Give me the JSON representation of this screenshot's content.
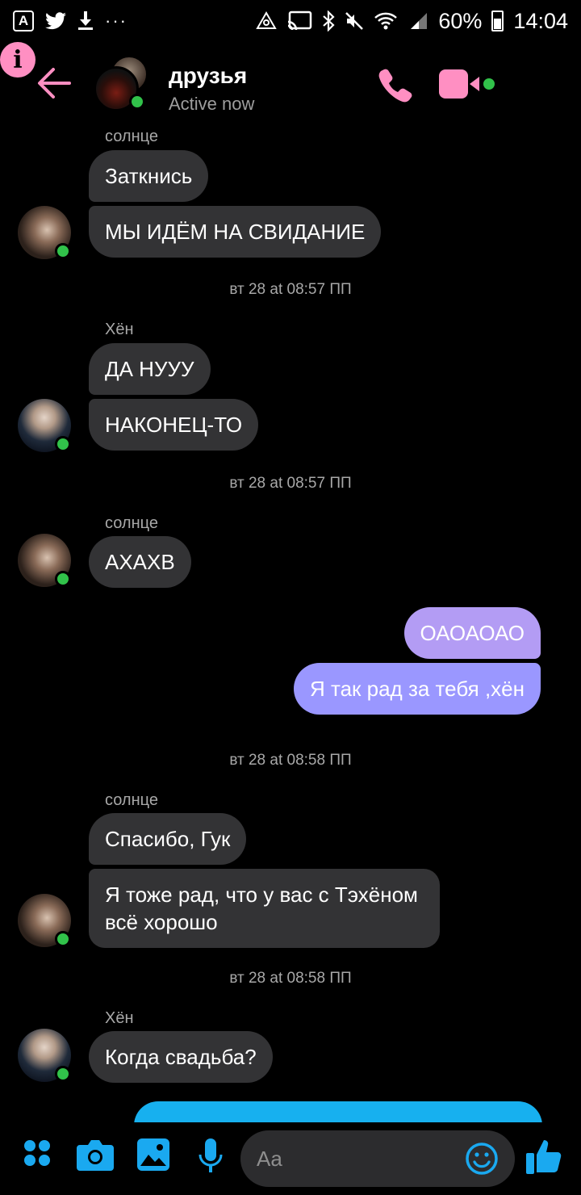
{
  "status_bar": {
    "app_badge": "A",
    "more": "···",
    "battery": "60%",
    "time": "14:04"
  },
  "header": {
    "title": "друзья",
    "subtitle": "Active now",
    "accent_color": "#ff8fc2",
    "presence_color": "#31c24a"
  },
  "messages": [
    {
      "type": "sender",
      "text": "солнце"
    },
    {
      "type": "incoming",
      "text": "Заткнись"
    },
    {
      "type": "incoming",
      "text": "МЫ ИДЁМ НА СВИДАНИЕ"
    },
    {
      "type": "timestamp",
      "text": "вт 28 at 08:57 ПП"
    },
    {
      "type": "sender",
      "text": "Хён"
    },
    {
      "type": "incoming",
      "text": "ДА НУУУ"
    },
    {
      "type": "incoming",
      "text": "НАКОНЕЦ-ТО"
    },
    {
      "type": "timestamp",
      "text": "вт 28 at 08:57 ПП"
    },
    {
      "type": "sender",
      "text": "солнце"
    },
    {
      "type": "incoming",
      "text": "АХАХВ"
    },
    {
      "type": "outgoing",
      "text": "ОАОАОАО"
    },
    {
      "type": "outgoing",
      "text": "Я так рад за тебя ,хён"
    },
    {
      "type": "timestamp",
      "text": "вт 28 at 08:58 ПП"
    },
    {
      "type": "sender",
      "text": "солнце"
    },
    {
      "type": "incoming",
      "text": "Спасибо, Гук"
    },
    {
      "type": "incoming",
      "text": "Я тоже рад, что у вас с Тэхёном всё хорошо"
    },
    {
      "type": "timestamp",
      "text": "вт 28 at 08:58 ПП"
    },
    {
      "type": "sender",
      "text": "Хён"
    },
    {
      "type": "incoming",
      "text": "Когда свадьба?"
    }
  ],
  "composer": {
    "placeholder": "Aa",
    "accent_color": "#1aa9f0"
  },
  "colors": {
    "outgoing_top": "#b39cf4",
    "outgoing_bottom": "#9a97ff",
    "incoming_bubble": "#333335"
  }
}
